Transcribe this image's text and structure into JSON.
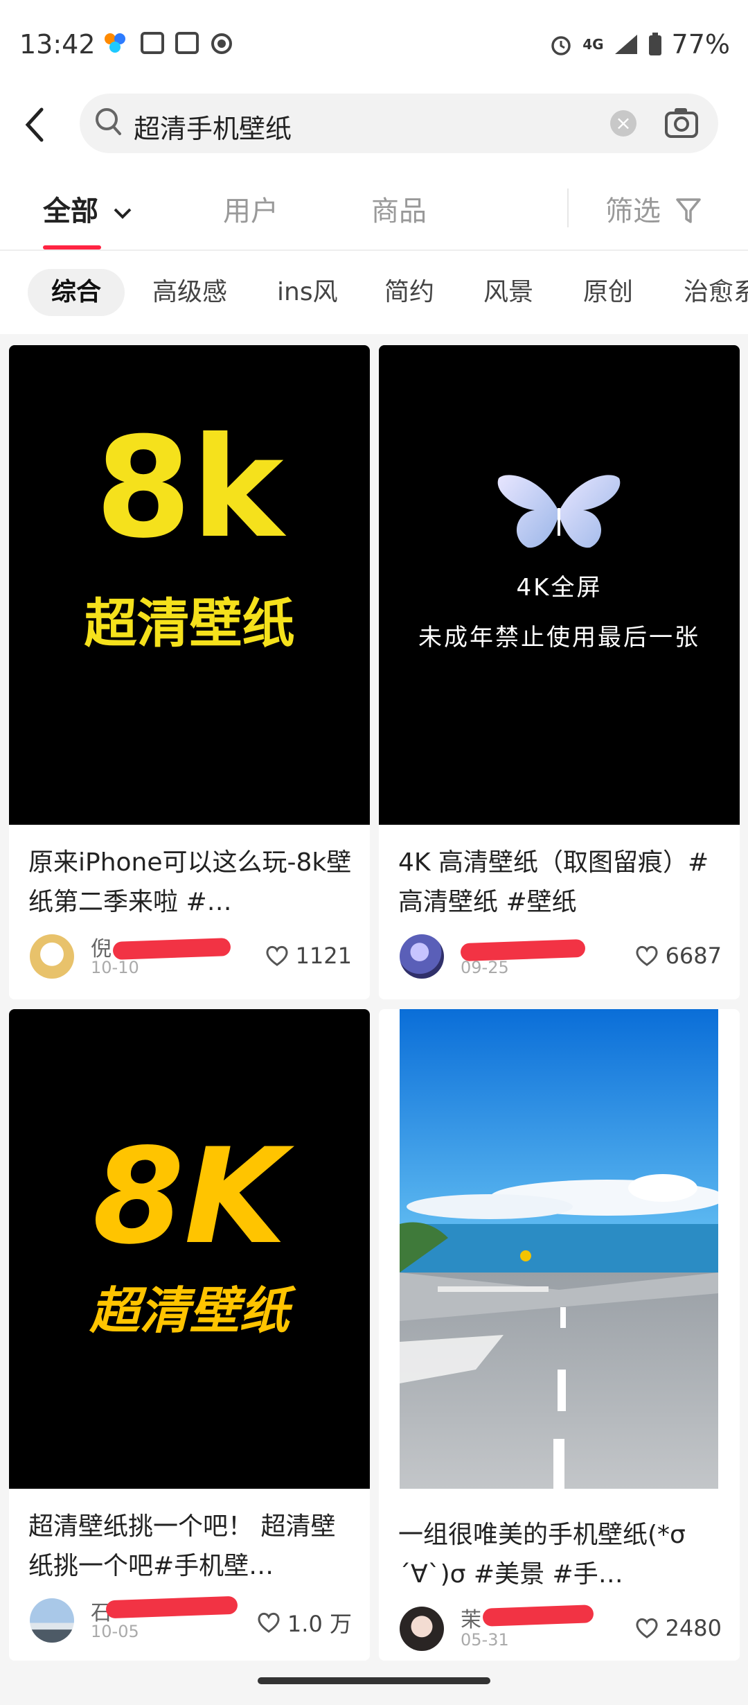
{
  "status_bar": {
    "time": "13:42",
    "network": "4G",
    "battery": "77%"
  },
  "search": {
    "query": "超清手机壁纸"
  },
  "tabs": [
    {
      "label": "全部"
    },
    {
      "label": "用户"
    },
    {
      "label": "商品"
    }
  ],
  "filter_label": "筛选",
  "chips": [
    "综合",
    "高级感",
    "ins风",
    "简约",
    "风景",
    "原创",
    "治愈系"
  ],
  "cards": [
    {
      "image_big": "8k",
      "image_sub": "超清壁纸",
      "title": "原来iPhone可以这么玩-8k壁纸第二季来啦 #…",
      "user": "倪",
      "date": "10-10",
      "likes": "1121"
    },
    {
      "image_line1": "4K全屏",
      "image_line2": "未成年禁止使用最后一张",
      "title": "4K 高清壁纸（取图留痕）#高清壁纸 #壁纸",
      "user": "",
      "date": "09-25",
      "likes": "6687"
    },
    {
      "image_big": "8K",
      "image_sub": "超清壁纸",
      "title": "超清壁纸挑一个吧！ 超清壁纸挑一个吧#手机壁…",
      "user": "石",
      "date": "10-05",
      "likes": "1.0 万"
    },
    {
      "title": "一组很唯美的手机壁纸(*σ´∀`)σ #美景 #手…",
      "user": "茉",
      "date": "05-31",
      "likes": "2480"
    }
  ],
  "colors": {
    "accent": "#ff2442",
    "yellow_8k": "#f5e11c",
    "orange_8k": "#ffc400"
  }
}
